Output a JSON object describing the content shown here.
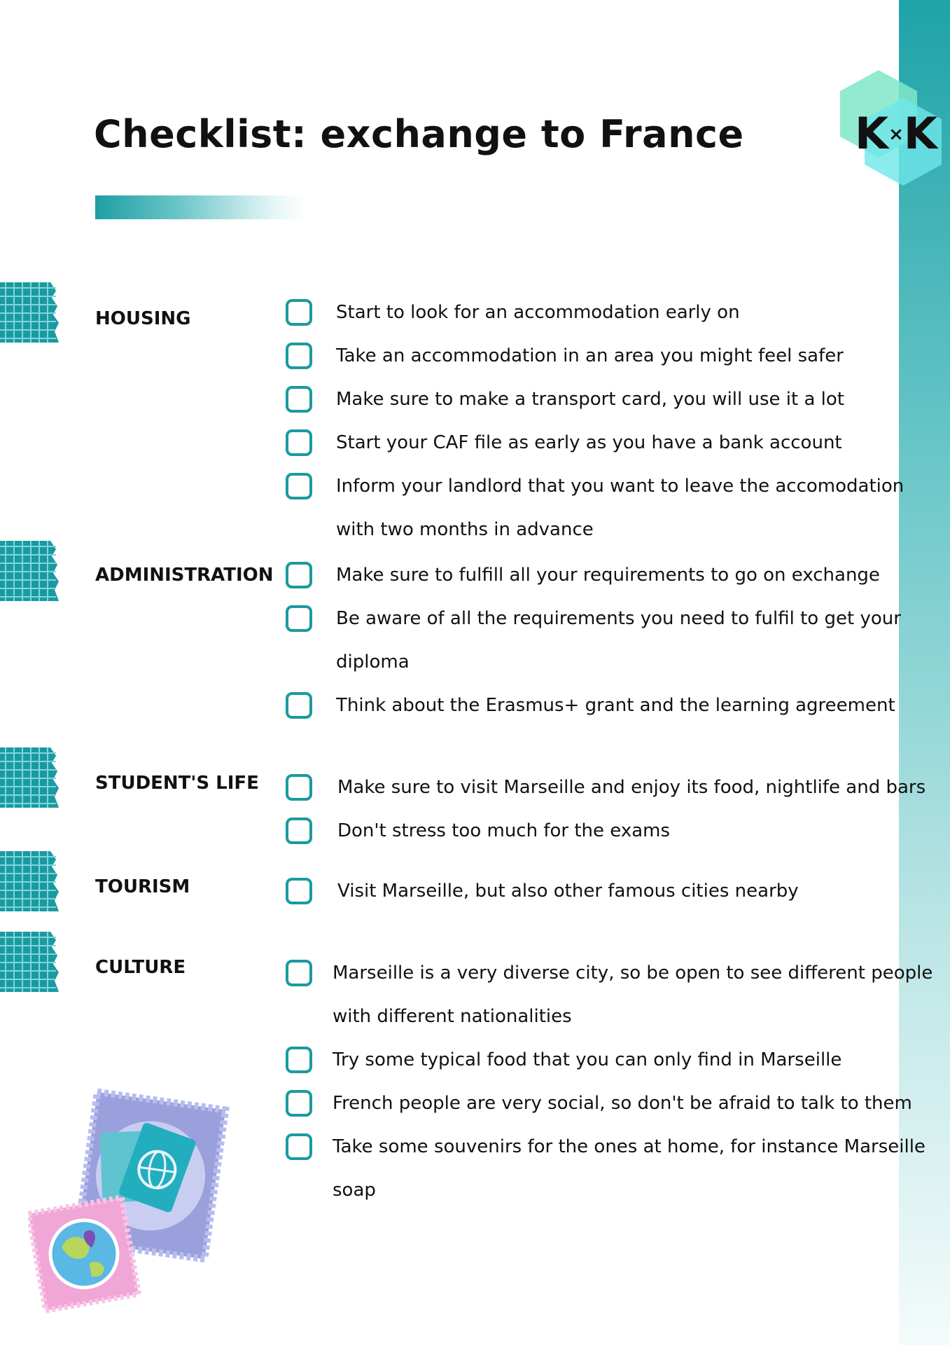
{
  "title": "Checklist: exchange to France",
  "logo": {
    "text_left": "K",
    "text_mid": "×",
    "text_right": "K"
  },
  "colors": {
    "accent": "#1b9a9e",
    "band_top": "#1fa3a8",
    "band_bottom": "#f4fbfb"
  },
  "sections": [
    {
      "label": "HOUSING",
      "items": [
        {
          "text": "Start to look for an accommodation early on"
        },
        {
          "text": "Take an accommodation in an area you might feel safer"
        },
        {
          "text": "Make sure to make a transport card, you will use it a lot"
        },
        {
          "text": "Start your CAF file as early as you have a bank account"
        },
        {
          "text": "Inform your landlord that you want to leave the accomodation",
          "cont": "with two months in advance"
        }
      ]
    },
    {
      "label": "ADMINISTRATION",
      "items": [
        {
          "text": "Make sure to fulfill all your requirements to go on exchange"
        },
        {
          "text": "Be aware of all the requirements you need to fulfil to get your",
          "cont": "diploma"
        },
        {
          "text": "Think about the Erasmus+ grant and the learning agreement"
        }
      ]
    },
    {
      "label": "STUDENT'S LIFE",
      "items": [
        {
          "text": "Make sure to visit Marseille and enjoy its food, nightlife and bars"
        },
        {
          "text": "Don't stress too much for the exams"
        }
      ]
    },
    {
      "label": "TOURISM",
      "items": [
        {
          "text": "Visit Marseille, but also other famous cities nearby"
        }
      ]
    },
    {
      "label": "CULTURE",
      "items": [
        {
          "text": "Marseille is a very diverse city, so be open to see different people",
          "cont": "with different nationalities"
        },
        {
          "text": "Try some typical food that you can only find in Marseille"
        },
        {
          "text": "French people are very social, so don't be afraid to talk to them"
        },
        {
          "text": "Take some souvenirs for the ones at home, for instance Marseille",
          "cont": "soap"
        }
      ]
    }
  ]
}
